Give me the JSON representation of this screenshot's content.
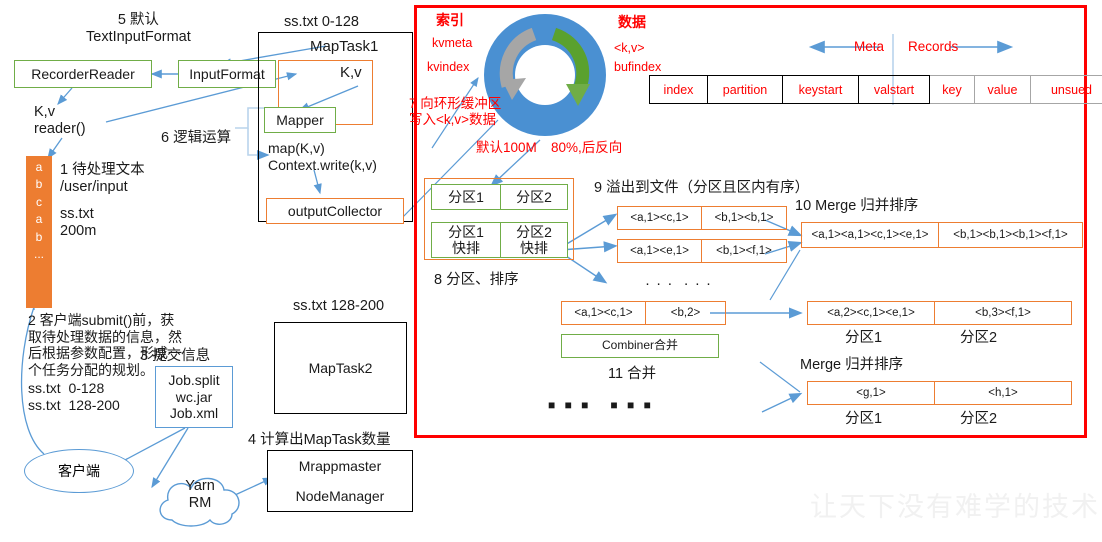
{
  "colors": {
    "red": "#ff0000",
    "orange": "#ed7d31",
    "green": "#70ad47",
    "blue": "#5b9bd5",
    "donut_blue": "#4a90d2",
    "arrow_green": "#5aa12e",
    "arrow_gray": "#a6a6a6"
  },
  "left": {
    "step5": "5 默认\nTextInputFormat",
    "recorder_reader": "RecorderReader",
    "input_format": "InputFormat",
    "kv_reader": "K,v\nreader()",
    "step1": "1 待处理文本\n/user/input",
    "step1_file": "ss.txt\n200m",
    "block_letters": [
      "a",
      "b",
      "c",
      "a",
      "b",
      "..."
    ],
    "step2": "2 客户端submit()前，获\n取待处理数据的信息，然\n后根据参数配置，形成一\n个任务分配的规划。",
    "step2_splits": "ss.txt  0-128\nss.txt  128-200",
    "step3": "3 提交信息",
    "job_box": "Job.split\nwc.jar\nJob.xml",
    "client": "客户端",
    "yarn": "Yarn\nRM",
    "step4": "4 计算出MapTask数量",
    "mrappmaster": "Mrappmaster",
    "nodemanager": "NodeManager"
  },
  "maptask1": {
    "split_label": "ss.txt 0-128",
    "title": "MapTask1",
    "kv": "K,v",
    "mapper": "Mapper",
    "step6": "6 逻辑运算",
    "map_calls": "map(K,v)\nContext.write(k,v)",
    "output_collector": "outputCollector"
  },
  "maptask2": {
    "split_label": "ss.txt 128-200",
    "title": "MapTask2"
  },
  "buffer": {
    "index_title": "索引",
    "kvmeta": "kvmeta",
    "kvindex": "kvindex",
    "data_title": "数据",
    "kv": "<k,v>",
    "bufindex": "bufindex",
    "step7": "7 向环形缓冲区\n写入<k,v>数据",
    "default_size": "默认100M",
    "threshold": "80%,后反向"
  },
  "meta_table": {
    "meta_label": "Meta",
    "records_label": "Records",
    "meta_cells": [
      "index",
      "partition",
      "keystart",
      "valstart"
    ],
    "record_cells": [
      "key",
      "value",
      "unsued"
    ]
  },
  "partition": {
    "step8": "8 分区、排序",
    "row1": [
      "分区1",
      "分区2"
    ],
    "row2": [
      "分区1\n快排",
      "分区2\n快排"
    ]
  },
  "spill": {
    "step9": "9 溢出到文件（分区且区内有序）",
    "files": [
      [
        "<a,1><c,1>",
        "<b,1><b,1>"
      ],
      [
        "<a,1><e,1>",
        "<b,1><f,1>"
      ]
    ],
    "ellipsis": "· · ·  · · ·"
  },
  "merge10": {
    "label": "10 Merge 归并排序",
    "cells": [
      "<a,1><a,1><c,1><e,1>",
      "<b,1><b,1><b,1><f,1>"
    ]
  },
  "combine": {
    "source_cells": [
      "<a,1><c,1>",
      "<b,2>"
    ],
    "combiner": "Combiner合并",
    "step11": "11 合并",
    "ellipsis": "■ ■ ■   ■ ■ ■"
  },
  "merge_final": {
    "top_cells": [
      "<a,2><c,1><e,1>",
      "<b,3><f,1>"
    ],
    "top_labels": [
      "分区1",
      "分区2"
    ],
    "label": "Merge 归并排序",
    "bottom_cells": [
      "<g,1>",
      "<h,1>"
    ],
    "bottom_labels": [
      "分区1",
      "分区2"
    ]
  },
  "watermark": "让天下没有难学的技术"
}
